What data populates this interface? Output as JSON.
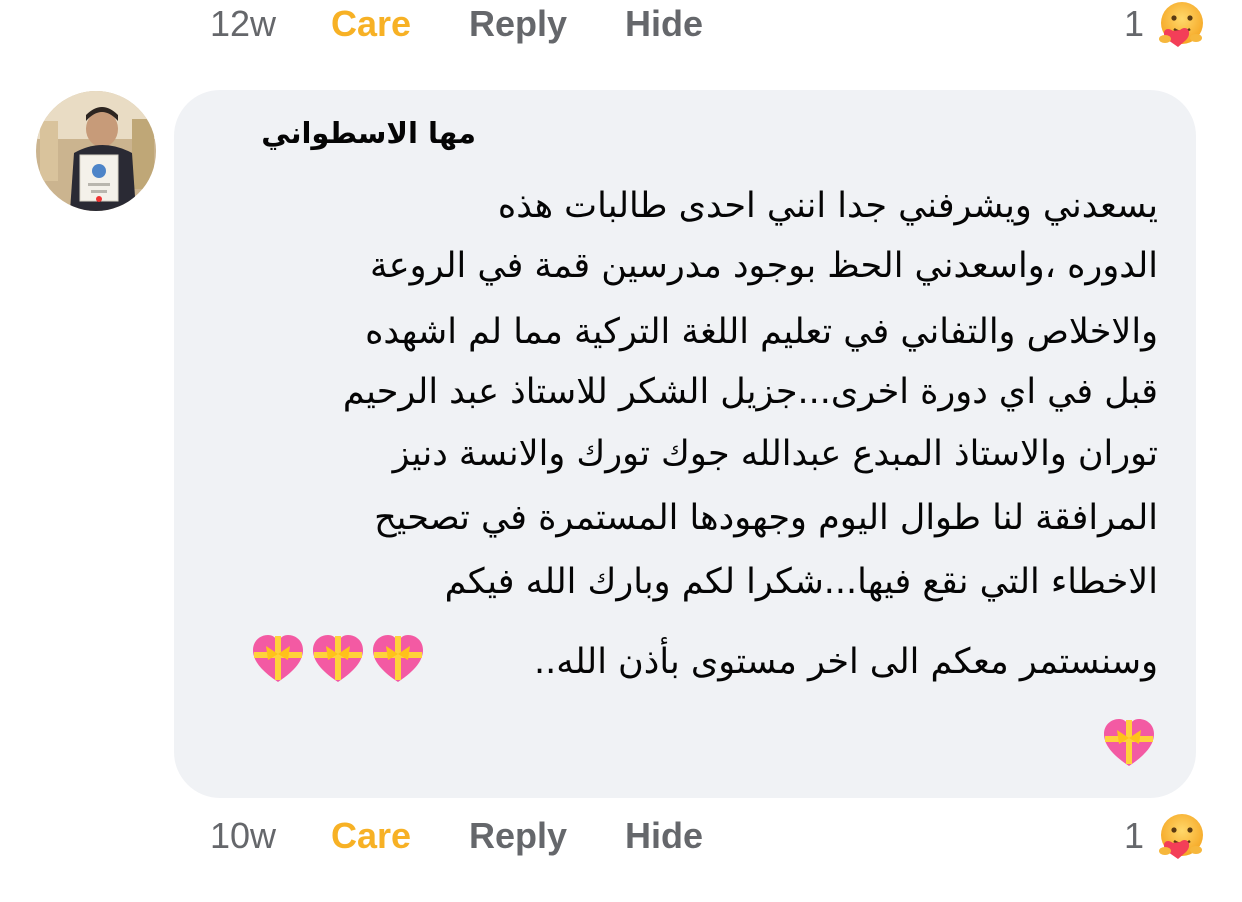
{
  "comments": [
    {
      "time": "12w",
      "actions": [
        "Care",
        "Reply",
        "Hide"
      ],
      "reaction_count": "1"
    },
    {
      "author": "مها الاسطواني",
      "body_lines": [
        "يسعدني ويشرفني جدا انني احدى طالبات هذه",
        "الدوره ،واسعدني الحظ بوجود مدرسين قمة في الروعة",
        "والاخلاص والتفاني في تعليم اللغة التركية مما لم اشهده",
        "قبل في اي دورة اخرى...جزيل الشكر للاستاذ عبد الرحيم",
        "توران والاستاذ المبدع عبدالله جوك تورك والانسة دنيز",
        "المرافقة لنا طوال اليوم وجهودها المستمرة في تصحيح",
        "الاخطاء التي نقع فيها...شكرا لكم وبارك الله فيكم",
        "وسنستمر معكم الى اخر مستوى بأذن الله.."
      ],
      "time": "10w",
      "actions": [
        "Care",
        "Reply",
        "Hide"
      ],
      "reaction_count": "1"
    }
  ],
  "colors": {
    "bubble": "#f0f2f5",
    "meta_text": "#65676b",
    "care_accent": "#f7b125",
    "text": "#050505"
  },
  "icons": {
    "reaction": "care-emoji-icon",
    "heart": "heart-with-ribbon-icon"
  }
}
